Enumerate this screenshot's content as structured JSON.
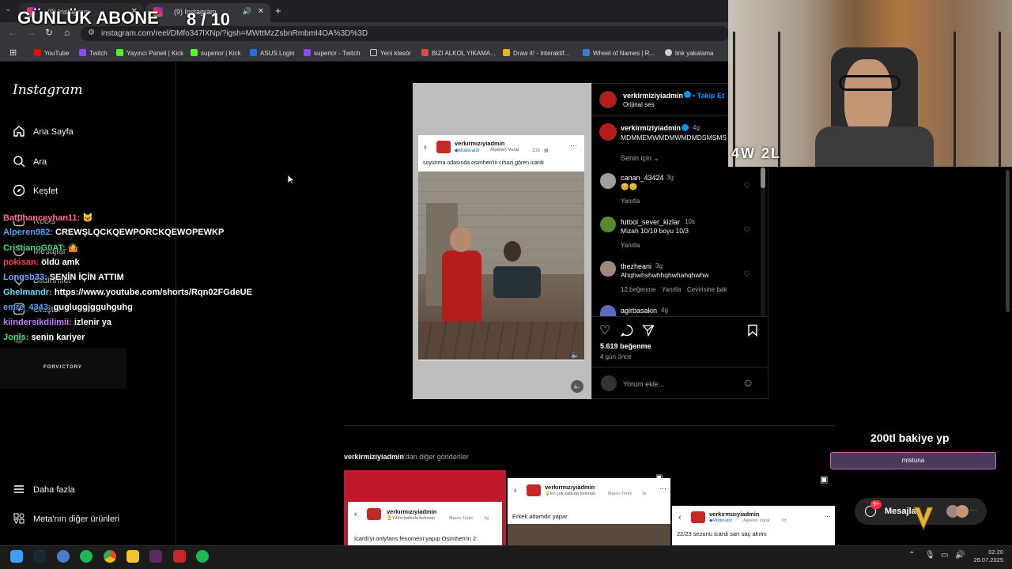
{
  "browser": {
    "tabs": [
      {
        "label": "(9) Instagram"
      },
      {
        "label": "(9) Instagram"
      }
    ],
    "url": "instagram.com/reel/DMfo347lXNp/?igsh=MWttMzZsbnRmbmI4OA%3D%3D",
    "bookmarks": [
      "YouTube",
      "Twitch",
      "Yayıncı Paneli | Kick",
      "superior | Kick",
      "ASUS Login",
      "superior - Twitch",
      "Yeni klasör",
      "BIZI ALKOL YIKAMA...",
      "Draw it! - Interaktif...",
      "Wheel of Names | R...",
      "link yakalama"
    ]
  },
  "overlay": {
    "goal_title": "GÜNLÜK ABONE",
    "goal_count": "8 / 10",
    "score": "4W 2L",
    "brand": "FORVICTORY",
    "donation_title": "200tl bakiye yp",
    "donation_user": "mtstuna"
  },
  "chat": [
    {
      "name": "Batuhanceyhan11:",
      "text": "",
      "color": "#ff4d6d"
    },
    {
      "name": "Alperen982:",
      "text": "CREWŞLQCKQEWPORCKQEWOPEWKP",
      "color": "#4ea3ff"
    },
    {
      "name": "CristianoG0AT:",
      "text": "",
      "color": "#3ddc84"
    },
    {
      "name": "pokisan:",
      "text": "öldü amk",
      "color": "#ff3b3b"
    },
    {
      "name": "Longsb33:",
      "text": "SENİN İÇİN ATTIM",
      "color": "#6fa8ff"
    },
    {
      "name": "Ghelmandr:",
      "text": "https://www.youtube.com/shorts/Rqn02FGdeUE",
      "color": "#5ddcff"
    },
    {
      "name": "emre_4343:",
      "text": "gugluggjgguhguhg",
      "color": "#4ea3ff"
    },
    {
      "name": "kiindersikdilimii:",
      "text": "izlenir ya",
      "color": "#c77dff"
    },
    {
      "name": "Jonis:",
      "text": "senin kariyer",
      "color": "#3ddc84"
    }
  ],
  "sidebar": {
    "logo": "Instagram",
    "items": [
      {
        "label": "Ana Sayfa",
        "icon": "home-icon"
      },
      {
        "label": "Ara",
        "icon": "search-icon"
      },
      {
        "label": "Keşfet",
        "icon": "compass-icon"
      },
      {
        "label": "Reels",
        "icon": "reels-icon"
      },
      {
        "label": "Mesajlar",
        "icon": "messenger-icon"
      },
      {
        "label": "Bildirimler",
        "icon": "heart-icon"
      },
      {
        "label": "Oluştur",
        "icon": "create-icon"
      },
      {
        "label": "Profil",
        "icon": "profile-icon"
      }
    ],
    "more": "Daha fazla",
    "meta": "Meta'nın diğer ürünleri"
  },
  "post": {
    "card": {
      "username": "verkırmızıyiadmin",
      "role": "Moderatör",
      "author": "Alperen Vural",
      "time": "10d",
      "caption": "soyunma odasında osimhen'in cihazi gören icardi"
    },
    "header_user": "verkirmiziyiadmin",
    "follow": "Takip Et",
    "audio": "Orijinal ses",
    "main_comment": {
      "user": "verkirmiziyiadmin",
      "time": "4g",
      "text": "MDMMEMWMDMWMDMDSMSMS"
    },
    "sort": "Senin için",
    "comments": [
      {
        "user": "canan_43424",
        "time": "3g",
        "text": "😊😊",
        "reply": "Yanıtla"
      },
      {
        "user": "futbol_sever_kizlar",
        "time": "10s",
        "text": "Mizah 10/10 boyu 10/3",
        "reply": "Yanıtla"
      },
      {
        "user": "thezheani",
        "time": "3g",
        "text": "Ahqhwhshwhhqhwhahqhwhw",
        "likes": "12 beğenme",
        "reply": "Yanıtla",
        "translate": "Çevirisine bak"
      },
      {
        "user": "agirbasakin",
        "time": "4g",
        "text": ""
      }
    ],
    "likes": "5.619 beğenme",
    "date": "4 gün önce",
    "comment_placeholder": "Yorum ekle..."
  },
  "more_posts": {
    "title_user": "verkirmiziyiadmin",
    "title_rest": "'dan diğer gönderiler",
    "items": [
      {
        "username": "verkırmızıyiadmin",
        "badge": "Yıldız katkıda bulunan",
        "author": "Mauro Terim",
        "time": "1g",
        "text": "İcardi'yi onlyfans fenomeni yapıp Osimhen'in 2."
      },
      {
        "username": "verkırmızıyiadmin",
        "badge": "En çok katkıda bulunan",
        "author": "Mauro Terim",
        "time": "3s",
        "text": "Erkek adamdır yapar"
      },
      {
        "username": "verkırmızıyiadmin",
        "badge": "Moderatör",
        "author": "Alperen Vural",
        "time": "7d",
        "text": "22/23 sezonu icardi sarı saç akımı"
      }
    ]
  },
  "messages_pill": {
    "label": "Mesajlar",
    "badge": "9+"
  },
  "taskbar": {
    "time": "02:20",
    "date": "29.07.2025"
  }
}
